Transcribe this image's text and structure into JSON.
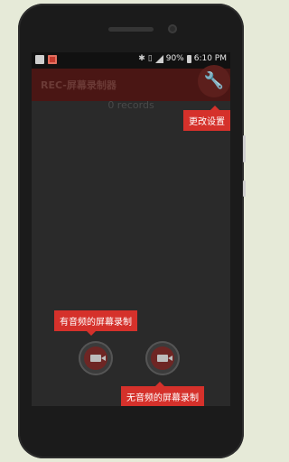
{
  "status_bar": {
    "battery": "90%",
    "time": "6:10 PM",
    "icons": [
      "image-icon",
      "record-icon",
      "bluetooth-icon",
      "vibrate-icon",
      "signal-icon",
      "battery-icon"
    ]
  },
  "app": {
    "title": "REC-屏幕录制器",
    "records_text": "0 records"
  },
  "tooltips": {
    "settings": "更改设置",
    "record_with_audio": "有音频的屏幕录制",
    "record_without_audio": "无音频的屏幕录制"
  },
  "colors": {
    "accent": "#d5312b",
    "toolbar": "#4a1614",
    "background": "#e6ead8"
  }
}
